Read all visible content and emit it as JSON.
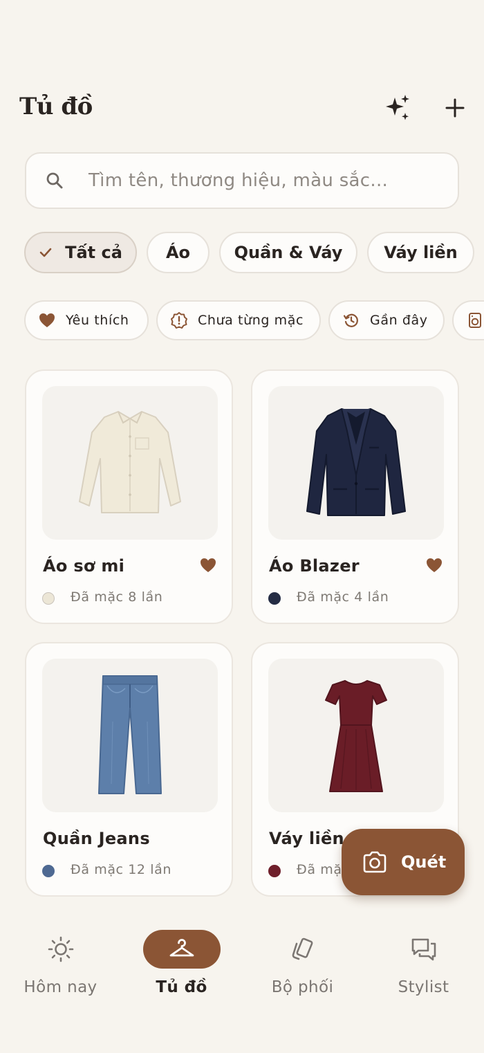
{
  "header": {
    "title": "Tủ đồ",
    "ai_icon": "sparkle-icon",
    "add_icon": "plus-icon"
  },
  "search": {
    "placeholder": "Tìm tên, thương hiệu, màu sắc..."
  },
  "categories": [
    {
      "label": "Tất cả",
      "selected": true
    },
    {
      "label": "Áo",
      "selected": false
    },
    {
      "label": "Quần & Váy",
      "selected": false
    },
    {
      "label": "Váy liền",
      "selected": false
    }
  ],
  "filters": [
    {
      "label": "Yêu thích",
      "icon": "heart-icon"
    },
    {
      "label": "Chưa từng mặc",
      "icon": "alert-badge-icon"
    },
    {
      "label": "Gần đây",
      "icon": "history-icon"
    },
    {
      "label": "",
      "icon": "laundry-icon"
    }
  ],
  "items": [
    {
      "name": "Áo sơ mi",
      "worn": "Đã mặc 8 lần",
      "favorite": true,
      "color": "#ece6d6",
      "image": "shirt-image"
    },
    {
      "name": "Áo Blazer",
      "worn": "Đã mặc 4 lần",
      "favorite": true,
      "color": "#242c44",
      "image": "blazer-image"
    },
    {
      "name": "Quần Jeans",
      "worn": "Đã mặc 12 lần",
      "favorite": false,
      "color": "#4e6992",
      "image": "jeans-image"
    },
    {
      "name": "Váy liền",
      "worn": "Đã mặc",
      "favorite": false,
      "color": "#6f1f2b",
      "image": "dress-image"
    }
  ],
  "fab": {
    "label": "Quét",
    "icon": "camera-icon"
  },
  "nav": [
    {
      "label": "Hôm nay",
      "icon": "sun-icon",
      "active": false
    },
    {
      "label": "Tủ đồ",
      "icon": "hanger-icon",
      "active": true
    },
    {
      "label": "Bộ phối",
      "icon": "cards-icon",
      "active": false
    },
    {
      "label": "Stylist",
      "icon": "chat-icon",
      "active": false
    }
  ],
  "colors": {
    "accent": "#8b5535",
    "background": "#f7f4ee",
    "card": "#fdfcfa"
  }
}
